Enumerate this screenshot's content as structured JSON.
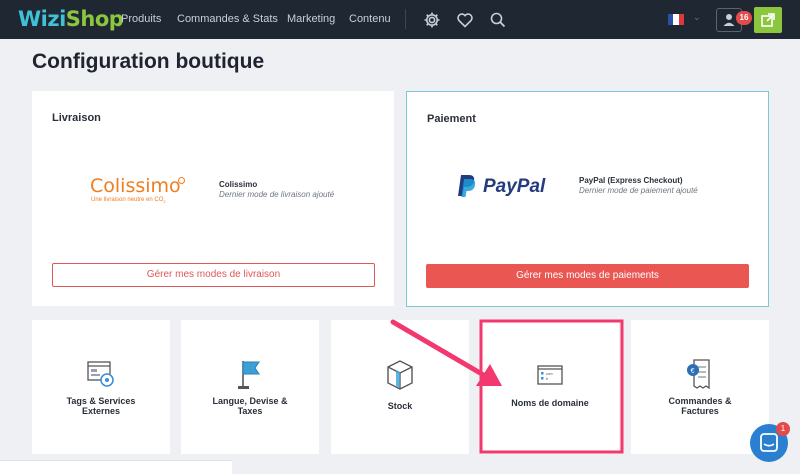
{
  "nav": {
    "logo_part1": "Wizi",
    "logo_part2": "Shop",
    "items": [
      {
        "label": "Produits"
      },
      {
        "label": "Commandes & Stats"
      },
      {
        "label": "Marketing"
      },
      {
        "label": "Contenu"
      }
    ],
    "notification_count": "16",
    "icons": [
      "gear-icon",
      "heart-icon",
      "search-icon",
      "flag-fr-icon",
      "user-icon",
      "external-link-icon"
    ]
  },
  "page": {
    "title": "Configuration boutique"
  },
  "shipping": {
    "heading": "Livraison",
    "logo_name": "Colissimo",
    "logo_tagline": "Une livraison neutre en CO",
    "logo_tagline_sub": "2",
    "method_name": "Colissimo",
    "method_sub": "Dernier mode de livraison ajouté",
    "button_label": "Gérer mes modes de livraison"
  },
  "payment": {
    "heading": "Paiement",
    "logo_name": "PayPal",
    "method_name": "PayPal (Express Checkout)",
    "method_sub": "Dernier mode de paiement ajouté",
    "button_label": "Gérer mes modes de paiements"
  },
  "tiles": [
    {
      "line1": "Tags & Services",
      "line2": "Externes",
      "icon": "tags-services-icon"
    },
    {
      "line1": "Langue, Devise &",
      "line2": "Taxes",
      "icon": "flag-icon"
    },
    {
      "line1": "Stock",
      "line2": "",
      "icon": "box-icon"
    },
    {
      "line1": "Noms de domaine",
      "line2": "",
      "icon": "domain-icon"
    },
    {
      "line1": "Commandes &",
      "line2": "Factures",
      "icon": "invoice-icon"
    }
  ],
  "domain_icon_text": {
    "com": ".com",
    "fr": ".fr"
  },
  "chat": {
    "badge": "1"
  },
  "colors": {
    "topbar": "#1f2733",
    "accent_blue": "#3fc1d6",
    "accent_green": "#8cc63f",
    "danger": "#ea5652",
    "highlight": "#f2386e"
  }
}
